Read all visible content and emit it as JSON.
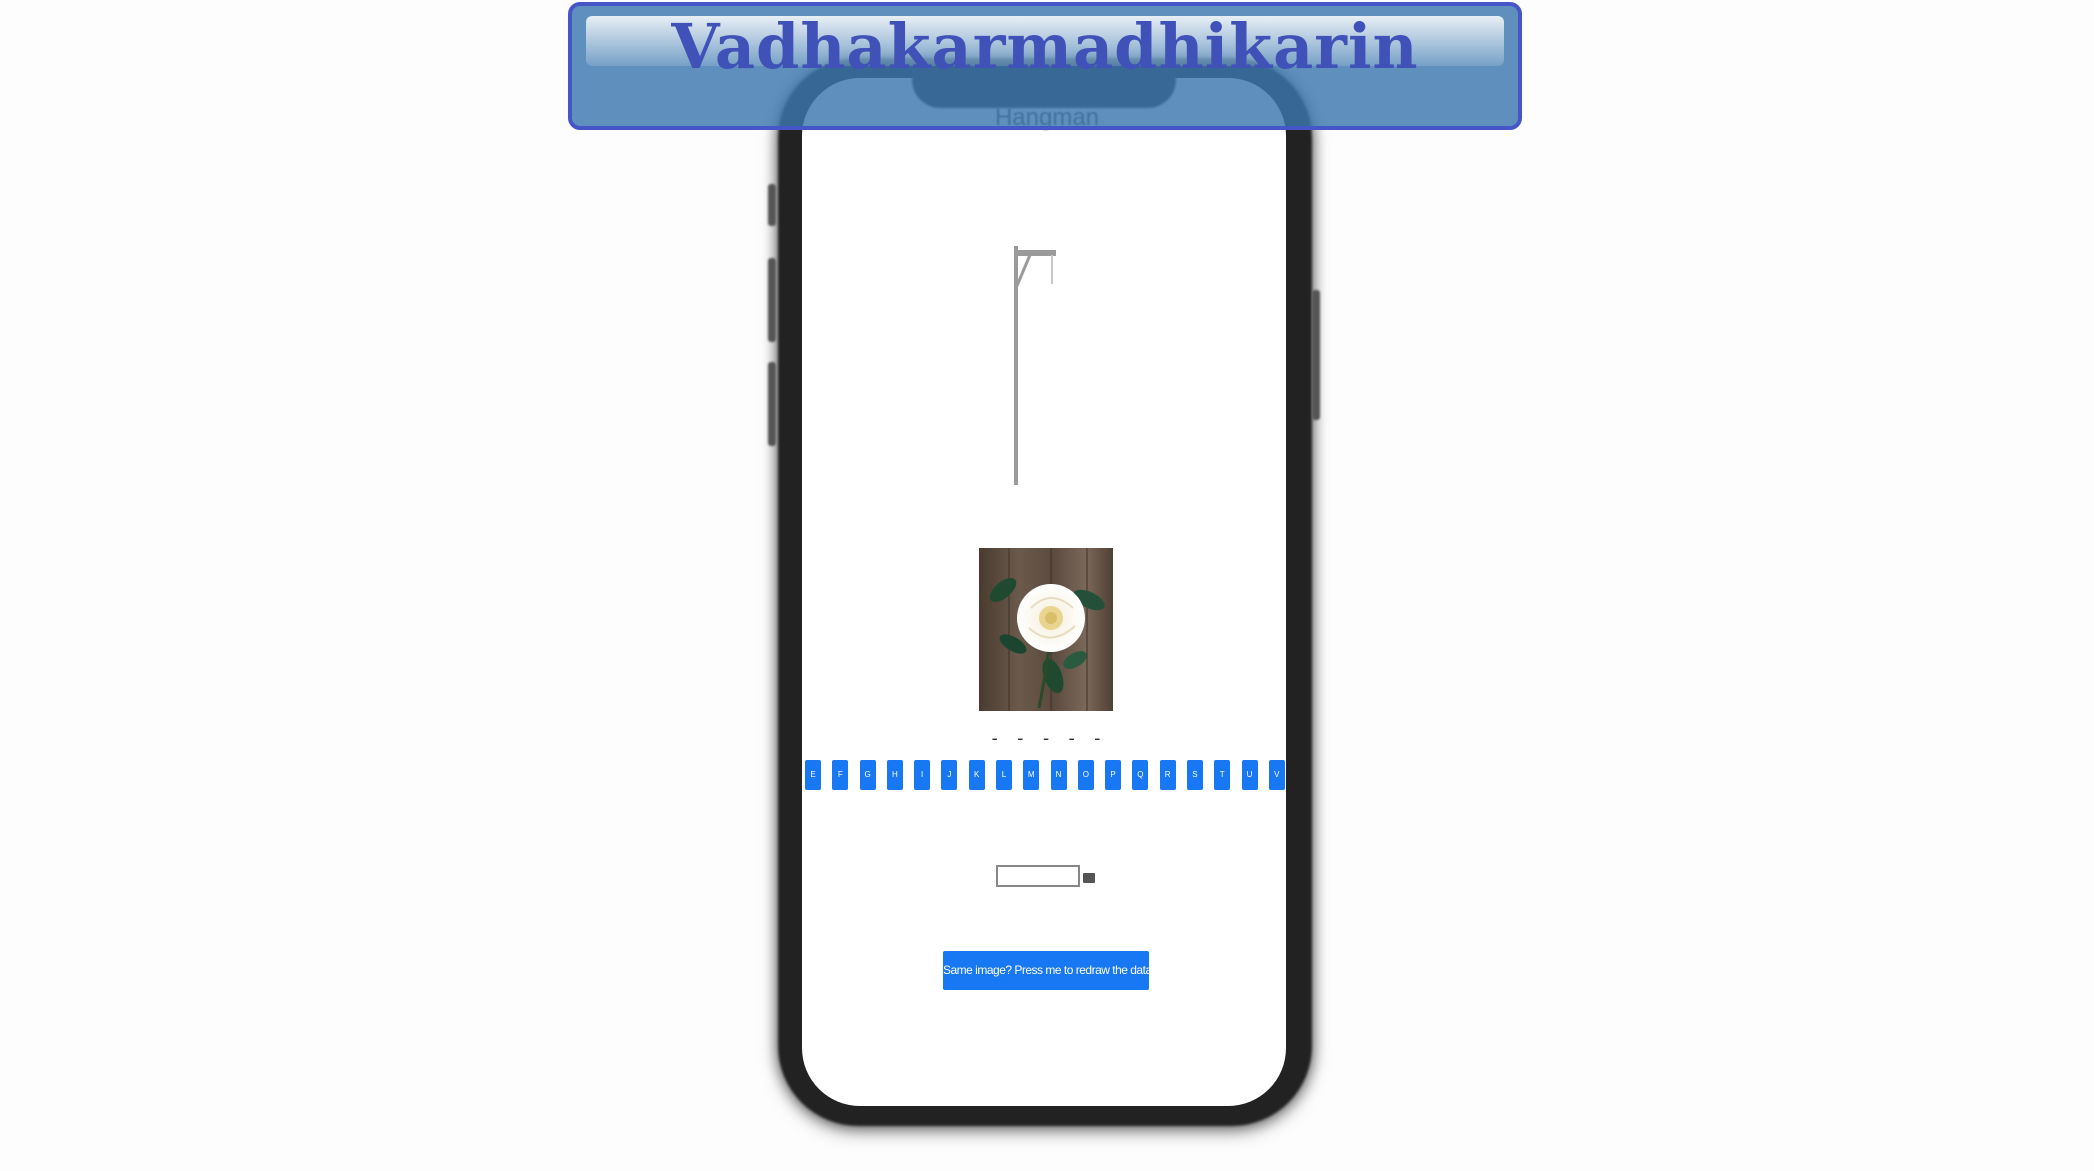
{
  "banner": {
    "title": "Vadhakarmadhikarin"
  },
  "app": {
    "label": "Hangman"
  },
  "game": {
    "word_display": "- - - - -",
    "letters": [
      "E",
      "F",
      "G",
      "H",
      "I",
      "J",
      "K",
      "L",
      "M",
      "N",
      "O",
      "P",
      "Q",
      "R",
      "S",
      "T",
      "U",
      "V"
    ]
  },
  "guess": {
    "value": ""
  },
  "actions": {
    "add_label": "Same image? Press me to redraw the database"
  },
  "icons": {
    "gallows": "gallows-icon",
    "picture": "white-rose-photo"
  },
  "colors": {
    "accent": "#1877f2",
    "banner_border": "#4656c8",
    "banner_title": "#4052b8"
  }
}
